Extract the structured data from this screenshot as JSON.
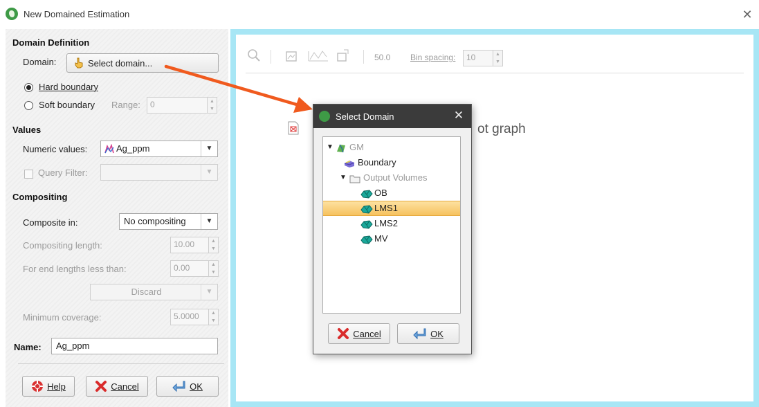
{
  "window": {
    "title": "New Domained Estimation",
    "close_glyph": "✕"
  },
  "domain_definition": {
    "title": "Domain Definition",
    "domain_label": "Domain:",
    "select_domain_button": "Select domain...",
    "hard_boundary_label": "Hard boundary",
    "hard_boundary_selected": true,
    "soft_boundary_label": "Soft boundary",
    "range_label": "Range:",
    "range_value": "0"
  },
  "values": {
    "title": "Values",
    "numeric_values_label": "Numeric values:",
    "numeric_values_selected": "Ag_ppm",
    "query_filter_label": "Query Filter:",
    "query_filter_value": ""
  },
  "compositing": {
    "title": "Compositing",
    "composite_in_label": "Composite in:",
    "composite_in_value": "No compositing",
    "compositing_length_label": "Compositing length:",
    "compositing_length_value": "10.00",
    "end_lengths_label": "For end lengths less than:",
    "end_lengths_value": "0.00",
    "end_action_value": "Discard",
    "minimum_coverage_label": "Minimum coverage:",
    "minimum_coverage_value": "5.0000"
  },
  "name": {
    "label": "Name:",
    "value": "Ag_ppm"
  },
  "footer_buttons": {
    "help": "Help",
    "cancel": "Cancel",
    "ok": "OK"
  },
  "graph_toolbar": {
    "value_label": "50.0",
    "bin_spacing_label": "Bin spacing:",
    "bin_spacing_value": "10",
    "graph_placeholder_fragment": "ot graph"
  },
  "select_domain_dialog": {
    "title": "Select Domain",
    "close_glyph": "✕",
    "tree": [
      {
        "label": "GM",
        "level": 0,
        "expanded": true,
        "muted": true,
        "icon": "geological-model-icon"
      },
      {
        "label": "Boundary",
        "level": 1,
        "muted": false,
        "icon": "boundary-icon"
      },
      {
        "label": "Output Volumes",
        "level": 1,
        "expanded": true,
        "muted": true,
        "icon": "folder-icon"
      },
      {
        "label": "OB",
        "level": 2,
        "muted": false,
        "icon": "volume-icon"
      },
      {
        "label": "LMS1",
        "level": 2,
        "muted": false,
        "selected": true,
        "icon": "volume-icon"
      },
      {
        "label": "LMS2",
        "level": 2,
        "muted": false,
        "icon": "volume-icon"
      },
      {
        "label": "MV",
        "level": 2,
        "muted": false,
        "icon": "volume-icon"
      }
    ],
    "cancel": "Cancel",
    "ok": "OK"
  },
  "colors": {
    "accent_arrow": "#f05a1e",
    "graph_frame": "#a7e6f5",
    "selection": "#f6c25f",
    "dialog_title_bar": "#3b3b3b",
    "volume_teal": "#1aa89a"
  }
}
